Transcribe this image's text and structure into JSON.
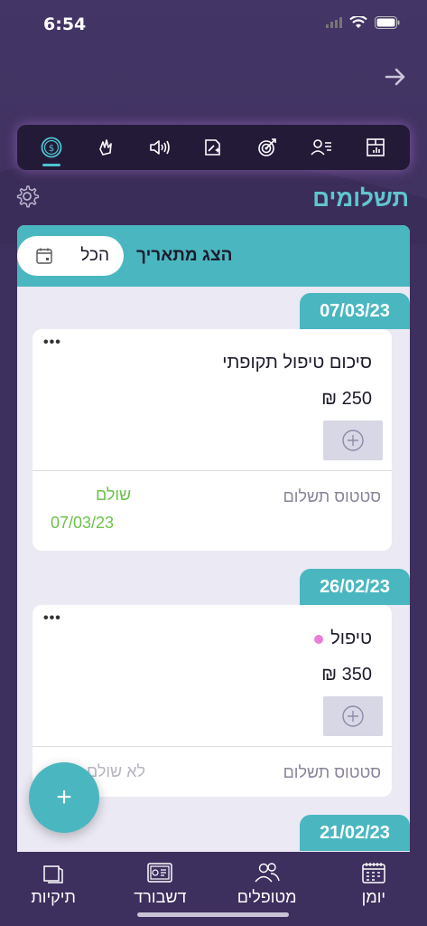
{
  "status_bar": {
    "time": "6:54"
  },
  "toolbar": {
    "items": [
      {
        "icon": "payments-icon",
        "active": true
      },
      {
        "icon": "gesture-icon",
        "active": false
      },
      {
        "icon": "sound-icon",
        "active": false
      },
      {
        "icon": "magic-icon",
        "active": false
      },
      {
        "icon": "target-icon",
        "active": false
      },
      {
        "icon": "person-list-icon",
        "active": false
      },
      {
        "icon": "report-icon",
        "active": false
      }
    ]
  },
  "page": {
    "title": "תשלומים"
  },
  "filter": {
    "label": "הצג מתאריך",
    "value": "הכל"
  },
  "entries": [
    {
      "date": "07/03/23",
      "title": "סיכום טיפול תקופתי",
      "amount": "250 ₪",
      "status_label": "סטטוס תשלום",
      "status_value": "שולם",
      "status_date": "07/03/23"
    },
    {
      "date": "26/02/23",
      "title": "טיפול",
      "amount": "350 ₪",
      "status_label": "סטטוס תשלום",
      "status_value": "לא שולם"
    },
    {
      "date": "21/02/23"
    }
  ],
  "colors": {
    "accent": "#4ab7c0",
    "paid": "#6cc24a",
    "background": "#3d2f5e"
  },
  "fab": {
    "label": "+"
  },
  "bottom_nav": {
    "items": [
      {
        "label": "יומן",
        "icon": "calendar-icon"
      },
      {
        "label": "מטופלים",
        "icon": "patients-icon"
      },
      {
        "label": "דשבורד",
        "icon": "dashboard-icon"
      },
      {
        "label": "תיקיות",
        "icon": "folders-icon"
      }
    ]
  }
}
